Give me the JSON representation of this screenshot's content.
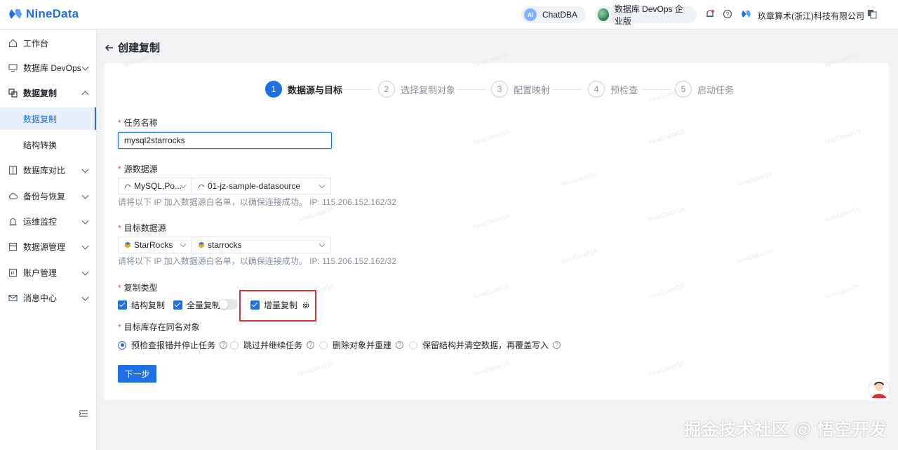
{
  "header": {
    "logo_text": "NineData",
    "chatdba_label": "ChatDBA",
    "devops_label": "数据库 DevOps 企业版",
    "company_name": "玖章算术(浙江)科技有限公司"
  },
  "sidebar": {
    "items": [
      {
        "label": "工作台"
      },
      {
        "label": "数据库 DevOps"
      },
      {
        "label": "数据复制"
      },
      {
        "label": "数据复制"
      },
      {
        "label": "结构转换"
      },
      {
        "label": "数据库对比"
      },
      {
        "label": "备份与恢复"
      },
      {
        "label": "运维监控"
      },
      {
        "label": "数据源管理"
      },
      {
        "label": "账户管理"
      },
      {
        "label": "消息中心"
      }
    ]
  },
  "page": {
    "title": "创建复制"
  },
  "steps": [
    {
      "num": "1",
      "label": "数据源与目标"
    },
    {
      "num": "2",
      "label": "选择复制对象"
    },
    {
      "num": "3",
      "label": "配置映射"
    },
    {
      "num": "4",
      "label": "预检查"
    },
    {
      "num": "5",
      "label": "启动任务"
    }
  ],
  "form": {
    "task_name_label": "任务名称",
    "task_name_value": "mysql2starrocks",
    "source_label": "源数据源",
    "source_type": "MySQL,Po...",
    "source_name": "01-jz-sample-datasource",
    "source_hint": "请将以下 IP 加入数据源白名单，以确保连接成功。 IP: 115.206.152.162/32",
    "target_label": "目标数据源",
    "target_type": "StarRocks",
    "target_name": "starrocks",
    "target_hint": "请将以下 IP 加入数据源白名单，以确保连接成功。 IP: 115.206.152.162/32",
    "copy_type_label": "复制类型",
    "copy_types": [
      "结构复制",
      "全量复制",
      "增量复制"
    ],
    "same_name_label": "目标库存在同名对象",
    "same_name_options": [
      "预检查报错并停止任务",
      "跳过并继续任务",
      "删除对象并重建",
      "保留结构并清空数据，再覆盖写入"
    ],
    "next_button": "下一步"
  },
  "watermark": "NineData#16",
  "footer_watermark": "掘金技术社区 @ 悟空开发",
  "colors": {
    "primary": "#1f6fe5",
    "highlight": "#e03131",
    "required": "#f53f3f"
  }
}
